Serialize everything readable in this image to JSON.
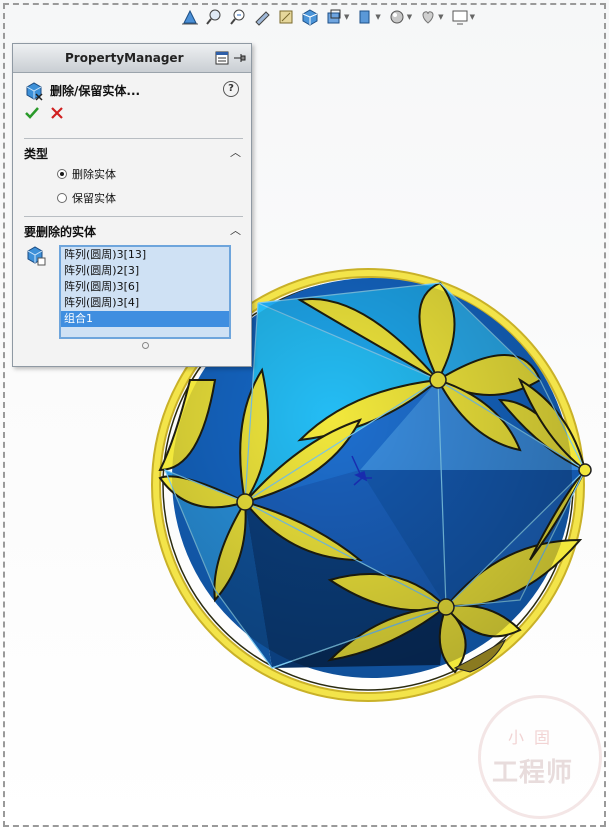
{
  "property_manager": {
    "header_title": "PropertyManager",
    "feature_title": "删除/保留实体...",
    "help_label": "?",
    "ok_icon": "checkmark-icon",
    "cancel_icon": "x-icon"
  },
  "type_group": {
    "title": "类型",
    "options": [
      {
        "label": "删除实体",
        "selected": true
      },
      {
        "label": "保留实体",
        "selected": false
      }
    ]
  },
  "bodies_group": {
    "title": "要删除的实体",
    "items": [
      {
        "label": "阵列(圆周)3[13]",
        "selected": false
      },
      {
        "label": "阵列(圆周)2[3]",
        "selected": false
      },
      {
        "label": "阵列(圆周)3[6]",
        "selected": false
      },
      {
        "label": "阵列(圆周)3[4]",
        "selected": false
      },
      {
        "label": "组合1",
        "selected": true
      }
    ]
  },
  "watermark": {
    "top_text": "小固",
    "main_text": "工程师"
  },
  "colors": {
    "accent_blue": "#3f8ee0",
    "model_yellow": "#f2e83c",
    "model_light_blue": "#29a9ee",
    "model_dark_blue": "#0a4c8c"
  }
}
